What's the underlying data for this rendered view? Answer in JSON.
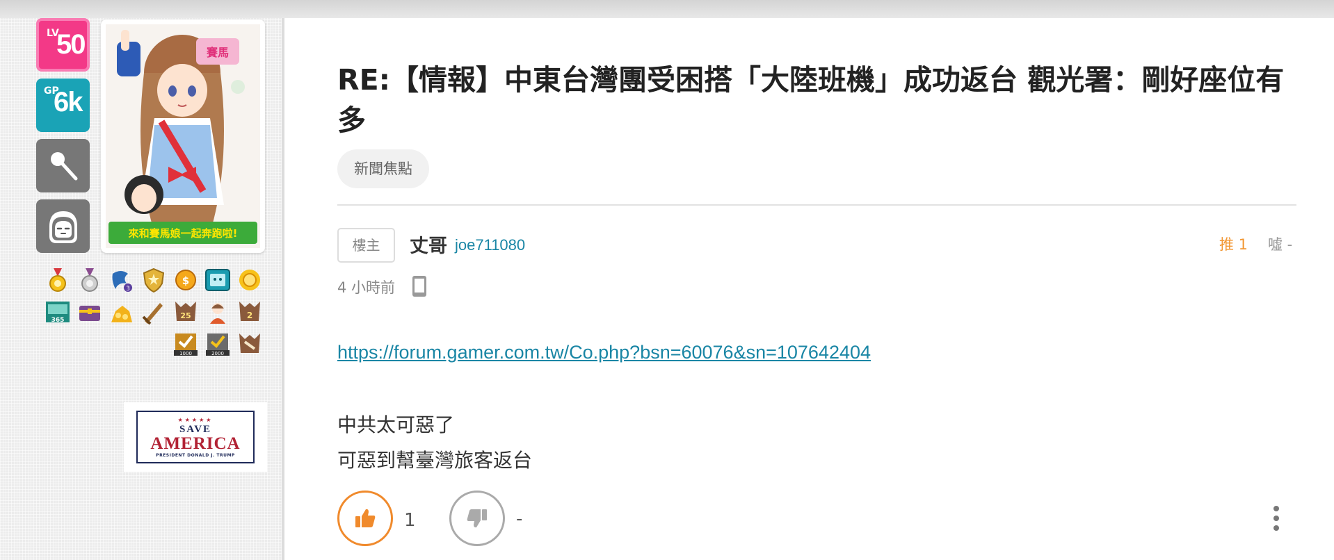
{
  "user": {
    "level_prefix": "LV",
    "level_value": "50",
    "gp_prefix": "GP",
    "gp_value": "6k",
    "tool_icon": "wand-icon",
    "face_icon": "face-icon",
    "avatar_caption": "來和賽馬娘一起奔跑啦!"
  },
  "badges": [
    "gold-medal-badge",
    "silver-medal-badge",
    "dragon-badge",
    "shield-badge",
    "coin-badge",
    "tv-badge",
    "sun-badge",
    "calendar-365-badge",
    "chest-badge",
    "gold-pile-badge",
    "sword-badge",
    "year-25-badge",
    "girl-badge",
    "number-2-badge",
    "check-1000-badge",
    "check-2000-badge",
    "horn-badge"
  ],
  "banner": {
    "stars": "★★★★★",
    "line1": "SAVE",
    "line2": "AMERICA",
    "line3": "PRESIDENT DONALD J. TRUMP"
  },
  "post": {
    "title": "RE:【情報】中東台灣團受困搭「大陸班機」成功返台 觀光署：剛好座位有多",
    "tag": "新聞焦點",
    "floor_label": "樓主",
    "author_nickname": "丈哥",
    "author_id": "joe711080",
    "push_label": "推 1",
    "boo_label": "噓 -",
    "time": "4 小時前",
    "device_icon": "mobile-phone-icon",
    "link": "https://forum.gamer.com.tw/Co.php?bsn=60076&sn=107642404",
    "body_lines": [
      "中共太可惡了",
      "可惡到幫臺灣旅客返台"
    ],
    "like_count": "1",
    "dislike_count": "-"
  },
  "colors": {
    "level": "#f33987",
    "gp": "#1aa3b6",
    "link": "#1a86a5",
    "push": "#f29733",
    "like_ring": "#f08a2c"
  }
}
